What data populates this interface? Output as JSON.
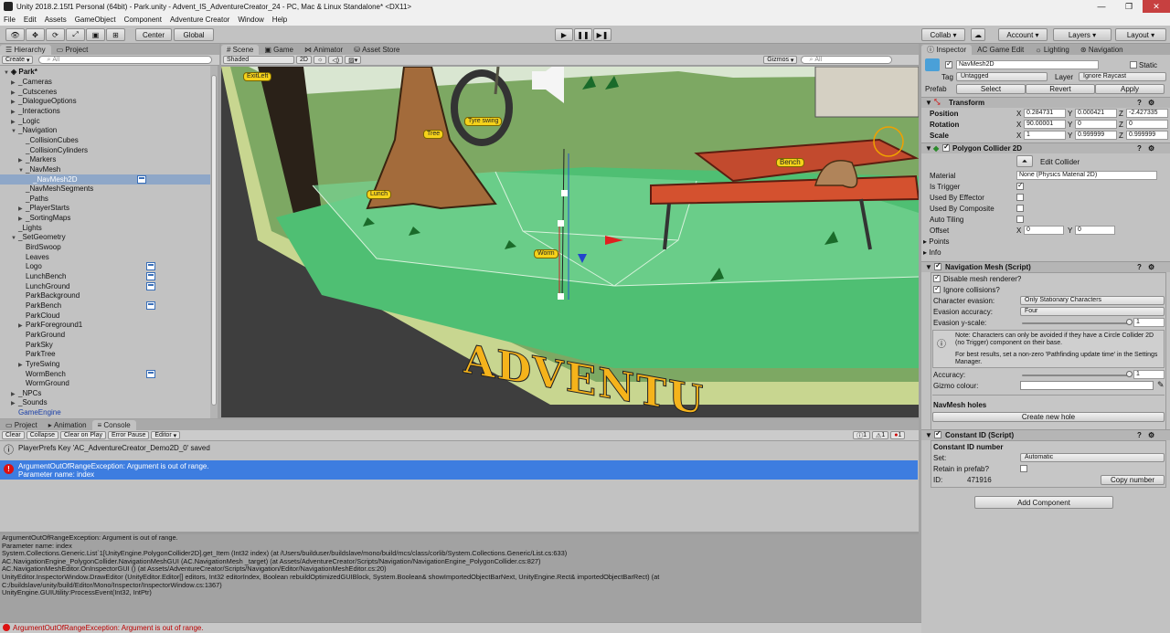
{
  "window": {
    "title": "Unity 2018.2.15f1 Personal (64bit) - Park.unity - Advent_IS_AdventureCreator_24 - PC, Mac & Linux Standalone* <DX11>"
  },
  "menu": [
    "File",
    "Edit",
    "Assets",
    "GameObject",
    "Component",
    "Adventure Creator",
    "Window",
    "Help"
  ],
  "toolbar": {
    "center": "Center",
    "global": "Global",
    "collab": "Collab",
    "account": "Account",
    "layers": "Layers",
    "layout": "Layout"
  },
  "hierarchy": {
    "tabs": [
      "Hierarchy",
      "Project"
    ],
    "create": "Create",
    "search": "All",
    "scene": "Park*",
    "rows": [
      [
        "_Cameras",
        1,
        "c"
      ],
      [
        "_Cutscenes",
        1,
        "c"
      ],
      [
        "_DialogueOptions",
        1,
        "c"
      ],
      [
        "_Interactions",
        1,
        "c"
      ],
      [
        "_Logic",
        1,
        "c"
      ],
      [
        "_Navigation",
        1,
        "o"
      ],
      [
        "_CollisionCubes",
        2,
        ""
      ],
      [
        "_CollisionCylinders",
        2,
        ""
      ],
      [
        "_Markers",
        2,
        "c"
      ],
      [
        "_NavMesh",
        2,
        "o"
      ],
      [
        "_NavMesh2D",
        3,
        "sel"
      ],
      [
        "_NavMeshSegments",
        2,
        ""
      ],
      [
        "_Paths",
        2,
        ""
      ],
      [
        "_PlayerStarts",
        2,
        "c"
      ],
      [
        "_SortingMaps",
        2,
        "c"
      ],
      [
        "_Lights",
        1,
        ""
      ],
      [
        "_SetGeometry",
        1,
        "o"
      ],
      [
        "BirdSwoop",
        2,
        ""
      ],
      [
        "Leaves",
        2,
        ""
      ],
      [
        "Logo",
        2,
        ""
      ],
      [
        "LunchBench",
        2,
        ""
      ],
      [
        "LunchGround",
        2,
        ""
      ],
      [
        "ParkBackground",
        2,
        ""
      ],
      [
        "ParkBench",
        2,
        ""
      ],
      [
        "ParkCloud",
        2,
        ""
      ],
      [
        "ParkForeground1",
        2,
        "c"
      ],
      [
        "ParkGround",
        2,
        ""
      ],
      [
        "ParkSky",
        2,
        ""
      ],
      [
        "ParkTree",
        2,
        ""
      ],
      [
        "TyreSwing",
        2,
        "c"
      ],
      [
        "WormBench",
        2,
        ""
      ],
      [
        "WormGround",
        2,
        ""
      ],
      [
        "_NPCs",
        1,
        "c"
      ],
      [
        "_Sounds",
        1,
        "c"
      ],
      [
        "GameEngine",
        1,
        "blue"
      ]
    ]
  },
  "scene": {
    "tabs": [
      "Scene",
      "Game",
      "Animator",
      "Asset Store"
    ],
    "shaded": "Shaded",
    "mode": "2D",
    "gizmos": "Gizmos",
    "search": "All",
    "labels": {
      "exit": "ExitLeft",
      "tree": "Tree",
      "tyre": "Tyre swing",
      "lunch": "Lunch",
      "worm": "Worm",
      "bench": "Bench"
    },
    "sign": "ADVENTU"
  },
  "console": {
    "tabs": [
      "Project",
      "Animation",
      "Console"
    ],
    "buttons": [
      "Clear",
      "Collapse",
      "Clear on Play",
      "Error Pause",
      "Editor"
    ],
    "counts": [
      "1",
      "1",
      "1"
    ],
    "log1": "PlayerPrefs Key 'AC_AdventureCreator_Demo2D_0' saved",
    "err1": "ArgumentOutOfRangeException: Argument is out of range.",
    "err2": "Parameter name: index",
    "stack": [
      "ArgumentOutOfRangeException: Argument is out of range.",
      "Parameter name: index",
      "System.Collections.Generic.List`1[UnityEngine.PolygonCollider2D].get_Item (Int32 index) (at /Users/builduser/buildslave/mono/build/mcs/class/corlib/System.Collections.Generic/List.cs:633)",
      "AC.NavigationEngine_PolygonCollider.NavigationMeshGUI (AC.NavigationMesh _target) (at Assets/AdventureCreator/Scripts/Navigation/NavigationEngine_PolygonCollider.cs:827)",
      "AC.NavigationMeshEditor.OnInspectorGUI () (at Assets/AdventureCreator/Scripts/Navigation/Editor/NavigationMeshEditor.cs:20)",
      "UnityEditor.InspectorWindow.DrawEditor (UnityEditor.Editor[] editors, Int32 editorIndex, Boolean rebuildOptimizedGUIBlock, System.Boolean& showImportedObjectBarNext, UnityEngine.Rect& importedObjectBarRect) (at",
      "C:/buildslave/unity/build/Editor/Mono/Inspector/InspectorWindow.cs:1367)",
      "UnityEngine.GUIUtility:ProcessEvent(Int32, IntPtr)"
    ],
    "status": "ArgumentOutOfRangeException: Argument is out of range."
  },
  "inspector": {
    "tabs": [
      "Inspector",
      "AC Game Edit",
      "Lighting",
      "Navigation"
    ],
    "name": "NavMesh2D",
    "static": "Static",
    "tag_l": "Tag",
    "tag": "Untagged",
    "layer_l": "Layer",
    "layer": "Ignore Raycast",
    "prefab": "Prefab",
    "select": "Select",
    "revert": "Revert",
    "apply": "Apply",
    "transform": {
      "title": "Transform",
      "position": "Position",
      "rotation": "Rotation",
      "scale": "Scale",
      "px": "0.284731",
      "py": "0.000421",
      "pz": "-2.427335",
      "rx": "90.00001",
      "ry": "0",
      "rz": "0",
      "sx": "1",
      "sy": "0.999999",
      "sz": "0.999999",
      "x": "X",
      "y": "Y",
      "z": "Z"
    },
    "poly": {
      "title": "Polygon Collider 2D",
      "edit": "Edit Collider",
      "material": "Material",
      "material_v": "None (Physics Material 2D)",
      "trigger": "Is Trigger",
      "effector": "Used By Effector",
      "composite": "Used By Composite",
      "tiling": "Auto Tiling",
      "offset": "Offset",
      "ox": "0",
      "oy": "0",
      "points": "Points",
      "info": "Info"
    },
    "nav": {
      "title": "Navigation Mesh (Script)",
      "disable": "Disable mesh renderer?",
      "ignore": "Ignore collisions?",
      "evasion": "Character evasion:",
      "evasion_v": "Only Stationary Characters",
      "acc": "Evasion accuracy:",
      "acc_v": "Four",
      "yscale": "Evasion y-scale:",
      "yscale_v": "1",
      "note1": "Note: Characters can only be avoided if they have a Circle Collider 2D (no Trigger) component on their base.",
      "note2": "For best results, set a non-zero 'Pathfinding update time' in the Settings Manager.",
      "accuracy": "Accuracy:",
      "accuracy_v": "1",
      "gizmo": "Gizmo colour:",
      "holes": "NavMesh holes",
      "newhole": "Create new hole"
    },
    "cid": {
      "title": "Constant ID (Script)",
      "num": "Constant ID number",
      "set": "Set:",
      "set_v": "Automatic",
      "retain": "Retain in prefab?",
      "id": "ID:",
      "id_v": "471916",
      "copy": "Copy number"
    },
    "add": "Add Component"
  }
}
